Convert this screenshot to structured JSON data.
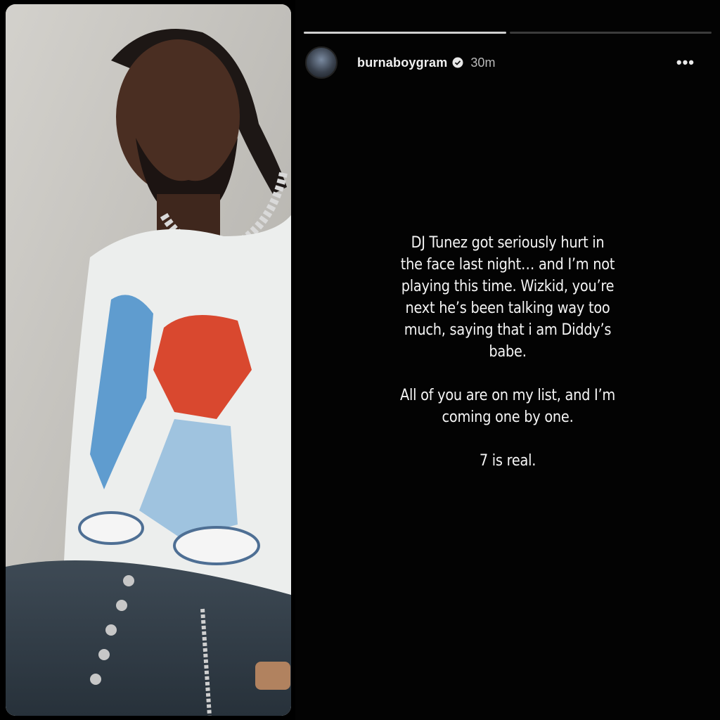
{
  "story": {
    "progress": [
      1.0,
      0.0
    ],
    "username": "burnaboygram",
    "time": "30m",
    "more_label": "•••",
    "verified_color": "#e8e8e8",
    "avatar_icon": "profile-avatar",
    "paragraphs": [
      {
        "lines": [
          "DJ Tunez got seriously hurt in",
          "the face last night… and I’m not",
          "playing this time. Wizkid, you’re",
          "next he’s been talking way too",
          "much, saying that i am Diddy’s",
          "babe."
        ]
      },
      {
        "lines": [
          "All of you are on my list, and I’m",
          "coming one by one."
        ]
      },
      {
        "lines": [
          "7 is real."
        ]
      }
    ]
  }
}
